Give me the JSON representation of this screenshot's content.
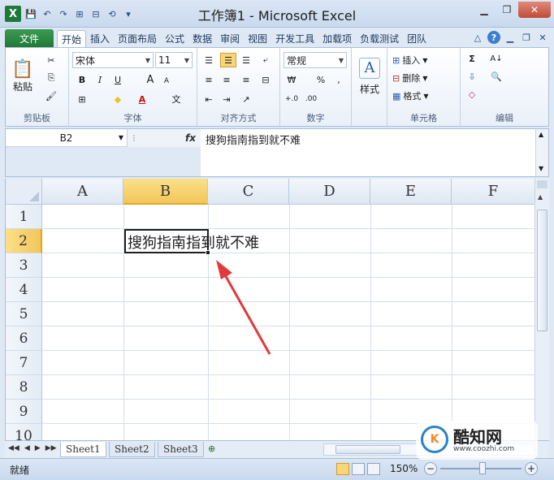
{
  "window": {
    "app_letter": "X",
    "title": "工作簿1 - Microsoft Excel",
    "controls": [
      "▁",
      "❐",
      "✕"
    ]
  },
  "quick_access": {
    "save": "💾",
    "undo": "↶",
    "redo": "↷",
    "extra1": "⊞",
    "extra2": "⊟",
    "extra3": "⟲",
    "customize": "▾"
  },
  "tabs": {
    "file": "文件",
    "items": [
      "开始",
      "插入",
      "页面布局",
      "公式",
      "数据",
      "审阅",
      "视图",
      "开发工具",
      "加载项",
      "负载测试",
      "团队"
    ],
    "active": "开始",
    "right_icons": [
      "△",
      "?",
      "▁",
      "❐",
      "✕"
    ]
  },
  "ribbon": {
    "clipboard": {
      "label": "剪贴板",
      "paste": "粘贴",
      "cut": "✂",
      "copy": "⎘",
      "painter": "🖌"
    },
    "font": {
      "label": "字体",
      "name": "宋体",
      "size": "11",
      "bold": "B",
      "italic": "I",
      "underline": "U",
      "grow": "A",
      "shrink": "A",
      "border": "⊞",
      "fill": "◆",
      "color": "A",
      "phonetic": "文"
    },
    "alignment": {
      "label": "对齐方式"
    },
    "number": {
      "label": "数字",
      "format": "常规",
      "currency": "₩",
      "percent": "%",
      "comma": ",",
      "inc": "+.0",
      "dec": ".00"
    },
    "styles": {
      "label": "样式",
      "icon": "A"
    },
    "cells": {
      "label": "单元格",
      "insert": "插入",
      "delete": "删除",
      "format": "格式"
    },
    "editing": {
      "label": "编辑",
      "sum": "Σ",
      "fill": "⇩",
      "clear": "◇",
      "sort": "A↓",
      "find": "🔍"
    }
  },
  "formula_bar": {
    "name_box": "B2",
    "fx": "fx",
    "content": "搜狗指南指到就不难"
  },
  "grid": {
    "columns": [
      "A",
      "B",
      "C",
      "D",
      "E",
      "F"
    ],
    "rows": [
      "1",
      "2",
      "3",
      "4",
      "5",
      "6",
      "7",
      "8",
      "9",
      "10"
    ],
    "selected_column": "B",
    "selected_row": "2",
    "active_cell": "B2",
    "b2_value": "搜狗指南指到就不难"
  },
  "sheets": {
    "tabs": [
      "Sheet1",
      "Sheet2",
      "Sheet3"
    ],
    "active": "Sheet1",
    "nav": [
      "◀◀",
      "◀",
      "▶",
      "▶▶"
    ]
  },
  "status": {
    "ready": "就绪",
    "zoom": "150%",
    "minus": "−",
    "plus": "+"
  },
  "watermark": {
    "logo": "K",
    "title": "酷知网",
    "url": "www.coozhi.com"
  },
  "colors": {
    "file_tab": "#207a36",
    "selection_header": "#f2c65a",
    "annotation_arrow": "#e03a3a"
  }
}
